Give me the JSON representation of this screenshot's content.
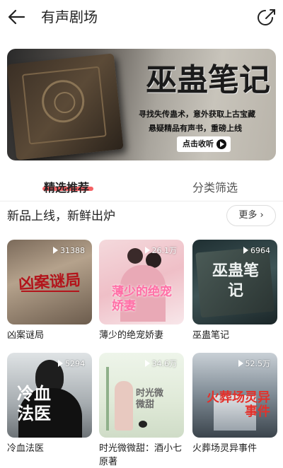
{
  "header": {
    "title": "有声剧场",
    "back_icon": "arrow-left-icon",
    "share_icon": "share-icon"
  },
  "banner": {
    "title": "巫蛊笔记",
    "line1": "寻找失传蛊术，意外获取上古宝藏",
    "line2": "悬疑精品有声书，重磅上线",
    "button_label": "点击收听"
  },
  "tabs": [
    {
      "label": "精选推荐",
      "active": true
    },
    {
      "label": "分类筛选",
      "active": false
    }
  ],
  "section": {
    "title": "新品上线，新鲜出炉",
    "more_label": "更多"
  },
  "items": [
    {
      "title": "凶案谜局",
      "plays": "31388",
      "cover_text": "凶案谜局"
    },
    {
      "title": "薄少的绝宠娇妻",
      "plays": "26.1万",
      "cover_text": "薄少的绝宠娇妻"
    },
    {
      "title": "巫蛊笔记",
      "plays": "6964",
      "cover_text": "巫蛊笔记"
    },
    {
      "title": "冷血法医",
      "plays": "5294",
      "cover_text": "冷血法医"
    },
    {
      "title": "时光微微甜：酒小七原著",
      "plays": "34.6万",
      "cover_text": "时光微微甜"
    },
    {
      "title": "火葬场灵异事件",
      "plays": "52.5万",
      "cover_text": "火葬场灵异事件"
    }
  ],
  "colors": {
    "accent": "#f2474a"
  }
}
